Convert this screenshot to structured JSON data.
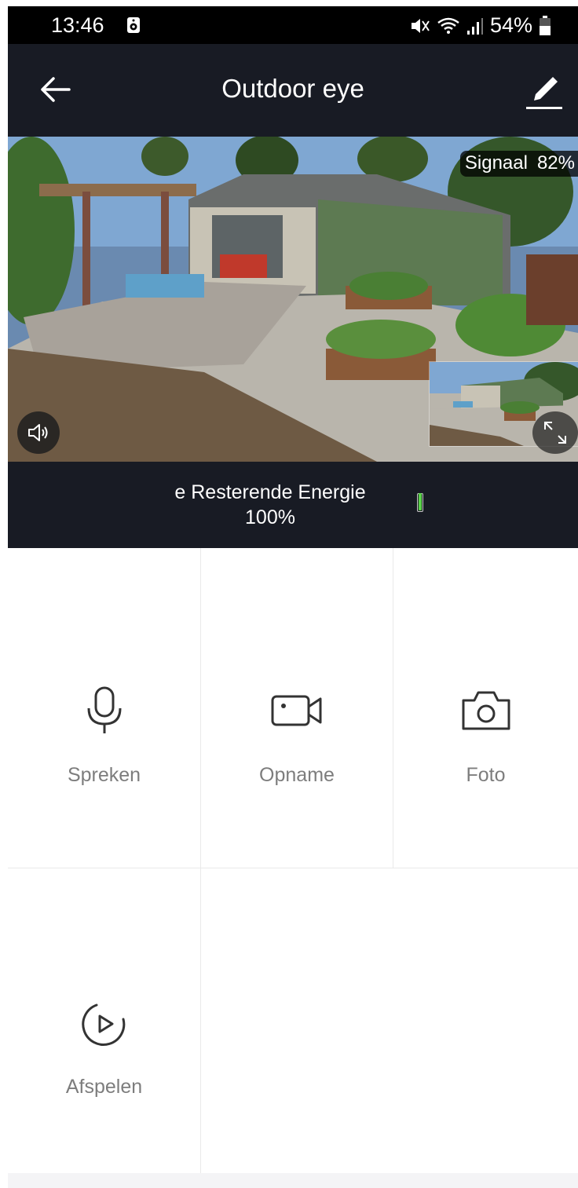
{
  "status_bar": {
    "time": "13:46",
    "battery_percent": "54%",
    "icons": [
      "notification-icon",
      "mute-icon",
      "wifi-icon",
      "signal-icon",
      "battery-icon"
    ]
  },
  "header": {
    "title": "Outdoor eye",
    "icons": [
      "back-arrow-icon",
      "edit-pencil-icon"
    ]
  },
  "video": {
    "signal_label": "Signaal",
    "signal_value": "82%",
    "icons": [
      "speaker-icon",
      "fullscreen-icon"
    ]
  },
  "energy": {
    "label": "e Resterende Energie",
    "value": "100%",
    "battery_level": 1.0,
    "battery_color": "#5bd24a"
  },
  "actions": [
    {
      "label": "Spreken",
      "icon": "microphone-icon"
    },
    {
      "label": "Opname",
      "icon": "video-camera-icon"
    },
    {
      "label": "Foto",
      "icon": "camera-icon"
    },
    {
      "label": "Afspelen",
      "icon": "playback-icon"
    }
  ],
  "colors": {
    "header_bg": "#181b24",
    "label_gray": "#7d7d7d",
    "divider": "#e9e9e9"
  }
}
